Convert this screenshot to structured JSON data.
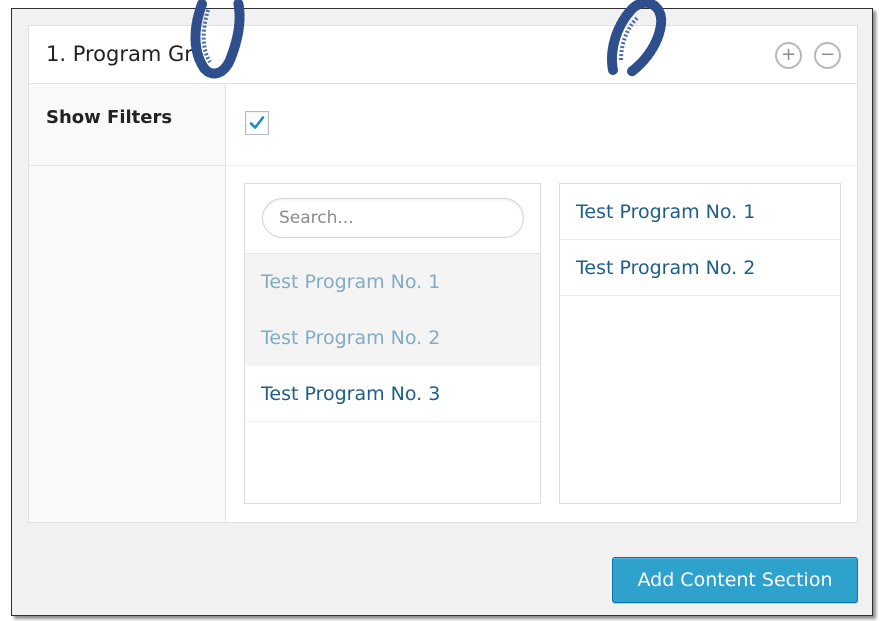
{
  "panel": {
    "title": "1. Program Gr",
    "add_icon": "plus-circle-icon",
    "remove_icon": "minus-circle-icon"
  },
  "filters": {
    "label": "Show Filters",
    "checked": true
  },
  "search": {
    "placeholder": "Search...",
    "value": ""
  },
  "available_items": [
    {
      "label": "Test Program No. 1",
      "state": "selected"
    },
    {
      "label": "Test Program No. 2",
      "state": "selected"
    },
    {
      "label": "Test Program No. 3",
      "state": "available"
    }
  ],
  "chosen_items": [
    {
      "label": "Test Program No. 1"
    },
    {
      "label": "Test Program No. 2"
    }
  ],
  "footer": {
    "add_button_label": "Add Content Section"
  },
  "colors": {
    "accent": "#2ea2cc",
    "link": "#1e5d87",
    "selected_text": "#82abc4"
  }
}
